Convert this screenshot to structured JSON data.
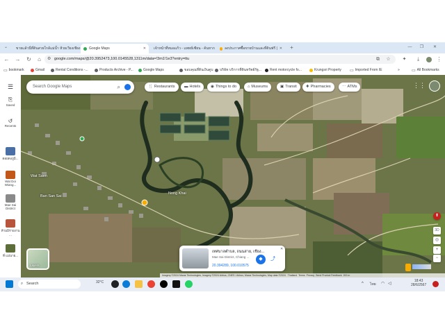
{
  "browser": {
    "tabs": [
      {
        "label": "ขายแล้วนี่ที่ดินสวยใกล้แม่น้ำ ห้วยเวียงเชียงแสน",
        "active": false
      },
      {
        "label": "Google Maps",
        "active": true
      },
      {
        "label": "เจ้าหน้าที่หมอแก้ว - แพทย์เซียน - ค้นหาก",
        "active": false
      },
      {
        "label": "ลงประกาศซื้อขายบ้านและที่ดินฟรี |",
        "active": false
      }
    ],
    "new_tab": "+",
    "url": "google.com/maps/@20.3952473,100.0145528,1311m/data=!3m1!1e3?entry=ttu",
    "bookmarks": [
      "bookmark",
      "Gmail",
      "Rental Conditions -...",
      "Products Archive - P...",
      "Google Maps",
      "ขอบคุณที่ดินเงินตูบ",
      "บริษัท บริการที่ดินทรัพย์รัฐ...",
      "Rent motorcycle fo...",
      "Krungsri Property",
      "Imported From IE"
    ],
    "all_bookmarks": "All Bookmarks"
  },
  "maps": {
    "search_placeholder": "Search Google Maps",
    "chips": [
      "Restaurants",
      "Hotels",
      "Things to do",
      "Museums",
      "Transit",
      "Pharmacies",
      "ATMs"
    ],
    "rail": {
      "saved": "Saved",
      "recents": "Recents",
      "recent_places": [
        "ดอยดงภูมิ...",
        "Wat Doi Wiang...",
        "Mae Sai District",
        "ห้ามมิรายงาน ...",
        "ที่ แม่นาย..."
      ]
    },
    "layers": "Layers",
    "place_labels": [
      "Wat Saen",
      "Ban San Sai",
      "Nong Khai"
    ],
    "card": {
      "title": "เทศบาลตำบล, ถนนสาย, เชียง...",
      "subtitle": "Mae Sai District, Chiang ...",
      "coords": "20.394289, 100.010575"
    },
    "attribution": "Imagery ©2024 Maxar Technologies, Imagery ©2024 Airbus, CNES / Airbus, Maxar Technologies, Map data ©2024",
    "footer_links": [
      "Thailand",
      "Terms",
      "Privacy",
      "Send Product Feedback",
      "200 m"
    ],
    "zoom_label": "3D"
  },
  "taskbar": {
    "search_label": "Search",
    "weather": "32°C",
    "language": "ไทย",
    "time": "18:43",
    "date": "28/6/2567"
  },
  "colors": {
    "chrome_tabstrip": "#dbe7f5",
    "map_field": "#6b7548",
    "river": "#1e2d1e",
    "accent": "#1a73e8"
  }
}
